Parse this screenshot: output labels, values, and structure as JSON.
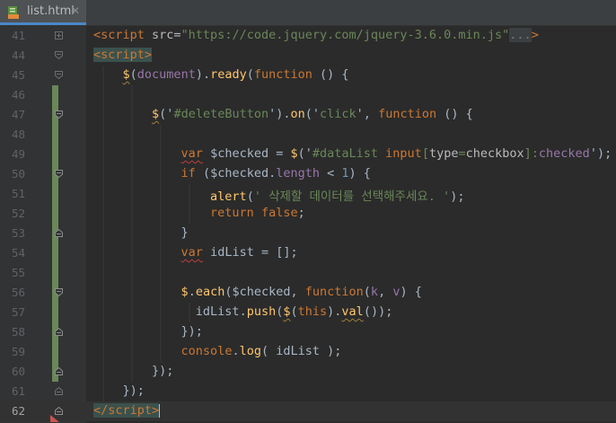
{
  "tab": {
    "filename": "list.html",
    "close_glyph": "✕",
    "icon": "html-file-icon"
  },
  "colors": {
    "background": "#2b2b2b",
    "gutter": "#313335",
    "keyword": "#cc7832",
    "string": "#6a8759",
    "number": "#6897bb",
    "function": "#ffc66d",
    "property": "#9876aa",
    "text": "#a9b7c6",
    "vcs_added": "#6a8759"
  },
  "editor": {
    "lines": [
      {
        "no": "41",
        "t": {
          "a": "<script",
          "b": " src=",
          "c": "\"https://code.jquery.com/jquery-3.6.0.min.js\"",
          "d": "...",
          "e": ">"
        }
      },
      {
        "no": "44",
        "t": {
          "a": "<script>"
        }
      },
      {
        "no": "45",
        "t": {
          "a": "$",
          "b": "(",
          "c": "document",
          "d": ").",
          "e": "ready",
          "f": "(",
          "g": "function",
          "h": " () {"
        }
      },
      {
        "no": "46"
      },
      {
        "no": "47",
        "t": {
          "a": "$",
          "b": "('",
          "c": "#deleteButton",
          "d": "').",
          "e": "on",
          "f": "('",
          "g": "click",
          "h": "', ",
          "i": "function",
          "j": " () {"
        }
      },
      {
        "no": "48"
      },
      {
        "no": "49",
        "t": {
          "a": "var",
          "b": " $checked = ",
          "c": "$",
          "d": "('",
          "e": "#dataList ",
          "f": "input",
          "g": "[",
          "h": "type",
          "i": "=",
          "j": "checkbox",
          "k": "]:",
          "l": "checked",
          "m": "');"
        }
      },
      {
        "no": "50",
        "t": {
          "a": "if",
          "b": " ($checked.",
          "c": "length",
          "d": " < ",
          "e": "1",
          "f": ") {"
        }
      },
      {
        "no": "51",
        "t": {
          "a": "alert",
          "b": "(",
          "c": "' 삭제할 데이터를 선택해주세요. '",
          "d": ");"
        }
      },
      {
        "no": "52",
        "t": {
          "a": "return false",
          "b": ";"
        }
      },
      {
        "no": "53",
        "t": {
          "a": "}"
        }
      },
      {
        "no": "54",
        "t": {
          "a": "var",
          "b": " idList = [];"
        }
      },
      {
        "no": "55"
      },
      {
        "no": "56",
        "t": {
          "a": "$",
          "b": ".",
          "c": "each",
          "d": "($checked, ",
          "e": "function",
          "f": "(",
          "g": "k",
          "h": ", ",
          "i": "v",
          "j": ") {"
        }
      },
      {
        "no": "57",
        "t": {
          "a": "idList.",
          "b": "push",
          "c": "(",
          "d": "$",
          "e": "(",
          "f": "this",
          "g": ").",
          "h": "val",
          "i": "());"
        }
      },
      {
        "no": "58",
        "t": {
          "a": "});"
        }
      },
      {
        "no": "59",
        "t": {
          "a": "console",
          "b": ".",
          "c": "log",
          "d": "( idList );"
        }
      },
      {
        "no": "60",
        "t": {
          "a": "});"
        }
      },
      {
        "no": "61",
        "t": {
          "a": "});"
        }
      },
      {
        "no": "62",
        "t": {
          "a": "</",
          "b": "script",
          "c": ">"
        }
      }
    ]
  }
}
